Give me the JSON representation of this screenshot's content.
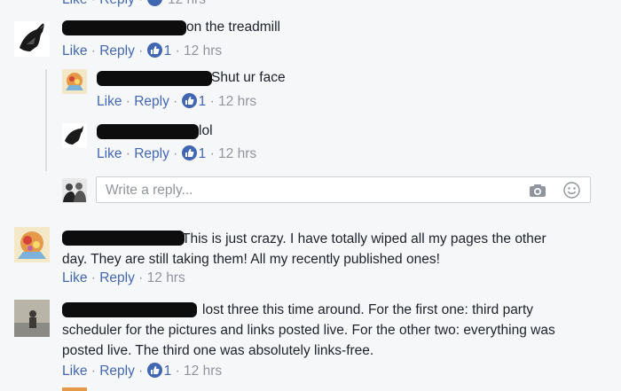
{
  "actions": {
    "like": "Like",
    "reply": "Reply",
    "sep": "·"
  },
  "top_partial": {
    "like": "Like",
    "reply": "Reply",
    "time": "12 hrs"
  },
  "comments": [
    {
      "text": "on the treadmill",
      "likes": "1",
      "time": "12 hrs"
    },
    {
      "text": "Shut ur face",
      "likes": "1",
      "time": "12 hrs"
    },
    {
      "text": "lol",
      "likes": "1",
      "time": "12 hrs"
    },
    {
      "text_line1": "This is just crazy. I have totally wiped all my pages the other",
      "text_line2": "day. They are still taking them! All my recently published ones!",
      "time": "12 hrs"
    },
    {
      "text_line1": "lost three this time around. For the first one: third party",
      "text_line2": "scheduler for the pictures and links posted live. For the other two: everything was",
      "text_line3": "posted live. The third one was absolutely links-free.",
      "likes": "1",
      "time": "12 hrs"
    }
  ],
  "reply_input": {
    "placeholder": "Write a reply..."
  },
  "colors": {
    "link": "#4267b2",
    "meta": "#90949c",
    "text": "#1d2129",
    "background": "#f6f7f9"
  }
}
